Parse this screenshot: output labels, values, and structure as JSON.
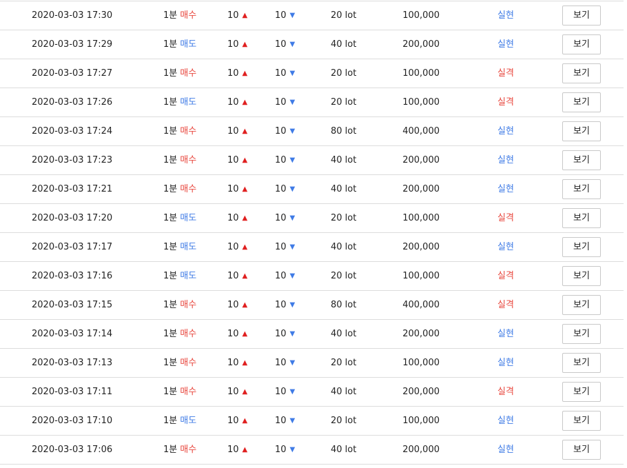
{
  "colors": {
    "buy": "#e8473e",
    "sell": "#3f7be6",
    "realized": "#3f7be6",
    "loss": "#e8473e",
    "up_arrow": "#e02020",
    "down_arrow": "#3f7be6"
  },
  "icons": {
    "up": "▲",
    "down": "▼"
  },
  "rows": [
    {
      "time": "2020-03-03 17:30",
      "interval": "1분",
      "side": "매수",
      "up": "10",
      "down": "10",
      "lot": "20 lot",
      "amount": "100,000",
      "result": "실현",
      "view": "보기"
    },
    {
      "time": "2020-03-03 17:29",
      "interval": "1분",
      "side": "매도",
      "up": "10",
      "down": "10",
      "lot": "40 lot",
      "amount": "200,000",
      "result": "실현",
      "view": "보기"
    },
    {
      "time": "2020-03-03 17:27",
      "interval": "1분",
      "side": "매수",
      "up": "10",
      "down": "10",
      "lot": "20 lot",
      "amount": "100,000",
      "result": "실격",
      "view": "보기"
    },
    {
      "time": "2020-03-03 17:26",
      "interval": "1분",
      "side": "매도",
      "up": "10",
      "down": "10",
      "lot": "20 lot",
      "amount": "100,000",
      "result": "실격",
      "view": "보기"
    },
    {
      "time": "2020-03-03 17:24",
      "interval": "1분",
      "side": "매수",
      "up": "10",
      "down": "10",
      "lot": "80 lot",
      "amount": "400,000",
      "result": "실현",
      "view": "보기"
    },
    {
      "time": "2020-03-03 17:23",
      "interval": "1분",
      "side": "매수",
      "up": "10",
      "down": "10",
      "lot": "40 lot",
      "amount": "200,000",
      "result": "실현",
      "view": "보기"
    },
    {
      "time": "2020-03-03 17:21",
      "interval": "1분",
      "side": "매수",
      "up": "10",
      "down": "10",
      "lot": "40 lot",
      "amount": "200,000",
      "result": "실현",
      "view": "보기"
    },
    {
      "time": "2020-03-03 17:20",
      "interval": "1분",
      "side": "매도",
      "up": "10",
      "down": "10",
      "lot": "20 lot",
      "amount": "100,000",
      "result": "실격",
      "view": "보기"
    },
    {
      "time": "2020-03-03 17:17",
      "interval": "1분",
      "side": "매도",
      "up": "10",
      "down": "10",
      "lot": "40 lot",
      "amount": "200,000",
      "result": "실현",
      "view": "보기"
    },
    {
      "time": "2020-03-03 17:16",
      "interval": "1분",
      "side": "매도",
      "up": "10",
      "down": "10",
      "lot": "20 lot",
      "amount": "100,000",
      "result": "실격",
      "view": "보기"
    },
    {
      "time": "2020-03-03 17:15",
      "interval": "1분",
      "side": "매수",
      "up": "10",
      "down": "10",
      "lot": "80 lot",
      "amount": "400,000",
      "result": "실격",
      "view": "보기"
    },
    {
      "time": "2020-03-03 17:14",
      "interval": "1분",
      "side": "매수",
      "up": "10",
      "down": "10",
      "lot": "40 lot",
      "amount": "200,000",
      "result": "실현",
      "view": "보기"
    },
    {
      "time": "2020-03-03 17:13",
      "interval": "1분",
      "side": "매수",
      "up": "10",
      "down": "10",
      "lot": "20 lot",
      "amount": "100,000",
      "result": "실현",
      "view": "보기"
    },
    {
      "time": "2020-03-03 17:11",
      "interval": "1분",
      "side": "매수",
      "up": "10",
      "down": "10",
      "lot": "40 lot",
      "amount": "200,000",
      "result": "실격",
      "view": "보기"
    },
    {
      "time": "2020-03-03 17:10",
      "interval": "1분",
      "side": "매도",
      "up": "10",
      "down": "10",
      "lot": "20 lot",
      "amount": "100,000",
      "result": "실현",
      "view": "보기"
    },
    {
      "time": "2020-03-03 17:06",
      "interval": "1분",
      "side": "매수",
      "up": "10",
      "down": "10",
      "lot": "40 lot",
      "amount": "200,000",
      "result": "실현",
      "view": "보기"
    }
  ]
}
